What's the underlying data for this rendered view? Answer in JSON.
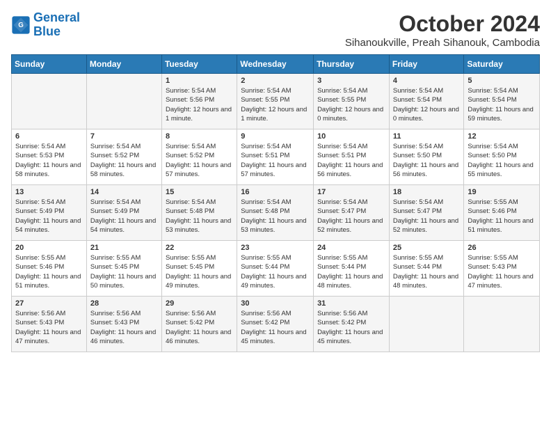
{
  "logo": {
    "line1": "General",
    "line2": "Blue"
  },
  "title": "October 2024",
  "subtitle": "Sihanoukville, Preah Sihanouk, Cambodia",
  "days_of_week": [
    "Sunday",
    "Monday",
    "Tuesday",
    "Wednesday",
    "Thursday",
    "Friday",
    "Saturday"
  ],
  "weeks": [
    [
      {
        "day": "",
        "info": ""
      },
      {
        "day": "",
        "info": ""
      },
      {
        "day": "1",
        "sunrise": "5:54 AM",
        "sunset": "5:56 PM",
        "daylight": "12 hours and 1 minute."
      },
      {
        "day": "2",
        "sunrise": "5:54 AM",
        "sunset": "5:55 PM",
        "daylight": "12 hours and 1 minute."
      },
      {
        "day": "3",
        "sunrise": "5:54 AM",
        "sunset": "5:55 PM",
        "daylight": "12 hours and 0 minutes."
      },
      {
        "day": "4",
        "sunrise": "5:54 AM",
        "sunset": "5:54 PM",
        "daylight": "12 hours and 0 minutes."
      },
      {
        "day": "5",
        "sunrise": "5:54 AM",
        "sunset": "5:54 PM",
        "daylight": "11 hours and 59 minutes."
      }
    ],
    [
      {
        "day": "6",
        "sunrise": "5:54 AM",
        "sunset": "5:53 PM",
        "daylight": "11 hours and 58 minutes."
      },
      {
        "day": "7",
        "sunrise": "5:54 AM",
        "sunset": "5:52 PM",
        "daylight": "11 hours and 58 minutes."
      },
      {
        "day": "8",
        "sunrise": "5:54 AM",
        "sunset": "5:52 PM",
        "daylight": "11 hours and 57 minutes."
      },
      {
        "day": "9",
        "sunrise": "5:54 AM",
        "sunset": "5:51 PM",
        "daylight": "11 hours and 57 minutes."
      },
      {
        "day": "10",
        "sunrise": "5:54 AM",
        "sunset": "5:51 PM",
        "daylight": "11 hours and 56 minutes."
      },
      {
        "day": "11",
        "sunrise": "5:54 AM",
        "sunset": "5:50 PM",
        "daylight": "11 hours and 56 minutes."
      },
      {
        "day": "12",
        "sunrise": "5:54 AM",
        "sunset": "5:50 PM",
        "daylight": "11 hours and 55 minutes."
      }
    ],
    [
      {
        "day": "13",
        "sunrise": "5:54 AM",
        "sunset": "5:49 PM",
        "daylight": "11 hours and 54 minutes."
      },
      {
        "day": "14",
        "sunrise": "5:54 AM",
        "sunset": "5:49 PM",
        "daylight": "11 hours and 54 minutes."
      },
      {
        "day": "15",
        "sunrise": "5:54 AM",
        "sunset": "5:48 PM",
        "daylight": "11 hours and 53 minutes."
      },
      {
        "day": "16",
        "sunrise": "5:54 AM",
        "sunset": "5:48 PM",
        "daylight": "11 hours and 53 minutes."
      },
      {
        "day": "17",
        "sunrise": "5:54 AM",
        "sunset": "5:47 PM",
        "daylight": "11 hours and 52 minutes."
      },
      {
        "day": "18",
        "sunrise": "5:54 AM",
        "sunset": "5:47 PM",
        "daylight": "11 hours and 52 minutes."
      },
      {
        "day": "19",
        "sunrise": "5:55 AM",
        "sunset": "5:46 PM",
        "daylight": "11 hours and 51 minutes."
      }
    ],
    [
      {
        "day": "20",
        "sunrise": "5:55 AM",
        "sunset": "5:46 PM",
        "daylight": "11 hours and 51 minutes."
      },
      {
        "day": "21",
        "sunrise": "5:55 AM",
        "sunset": "5:45 PM",
        "daylight": "11 hours and 50 minutes."
      },
      {
        "day": "22",
        "sunrise": "5:55 AM",
        "sunset": "5:45 PM",
        "daylight": "11 hours and 49 minutes."
      },
      {
        "day": "23",
        "sunrise": "5:55 AM",
        "sunset": "5:44 PM",
        "daylight": "11 hours and 49 minutes."
      },
      {
        "day": "24",
        "sunrise": "5:55 AM",
        "sunset": "5:44 PM",
        "daylight": "11 hours and 48 minutes."
      },
      {
        "day": "25",
        "sunrise": "5:55 AM",
        "sunset": "5:44 PM",
        "daylight": "11 hours and 48 minutes."
      },
      {
        "day": "26",
        "sunrise": "5:55 AM",
        "sunset": "5:43 PM",
        "daylight": "11 hours and 47 minutes."
      }
    ],
    [
      {
        "day": "27",
        "sunrise": "5:56 AM",
        "sunset": "5:43 PM",
        "daylight": "11 hours and 47 minutes."
      },
      {
        "day": "28",
        "sunrise": "5:56 AM",
        "sunset": "5:43 PM",
        "daylight": "11 hours and 46 minutes."
      },
      {
        "day": "29",
        "sunrise": "5:56 AM",
        "sunset": "5:42 PM",
        "daylight": "11 hours and 46 minutes."
      },
      {
        "day": "30",
        "sunrise": "5:56 AM",
        "sunset": "5:42 PM",
        "daylight": "11 hours and 45 minutes."
      },
      {
        "day": "31",
        "sunrise": "5:56 AM",
        "sunset": "5:42 PM",
        "daylight": "11 hours and 45 minutes."
      },
      {
        "day": "",
        "info": ""
      },
      {
        "day": "",
        "info": ""
      }
    ]
  ]
}
